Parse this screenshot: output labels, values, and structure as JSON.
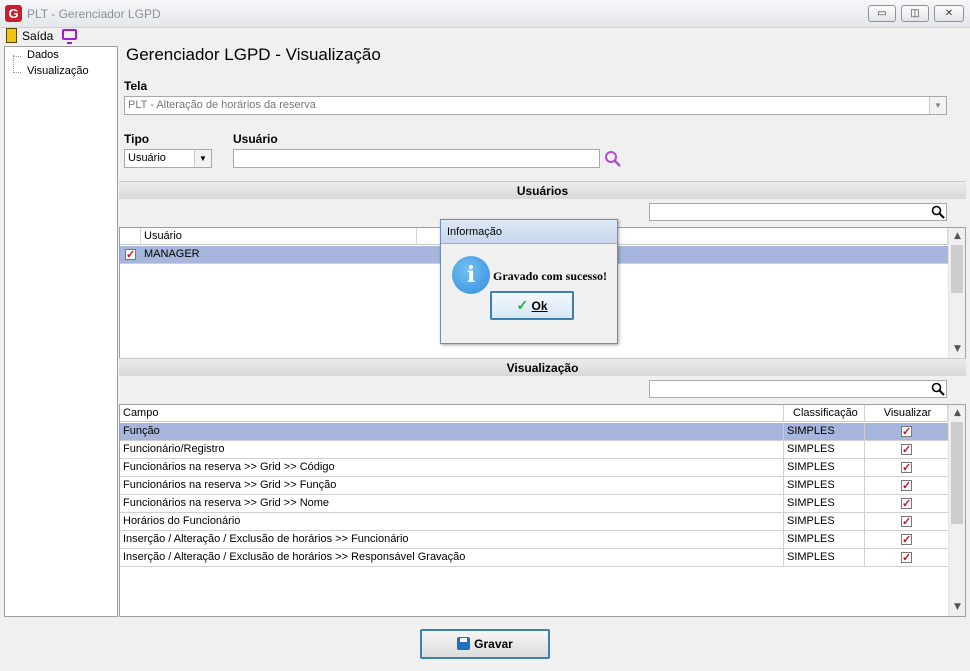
{
  "window": {
    "title": "PLT - Gerenciador LGPD",
    "app_icon": "G",
    "min_symbol": "▭",
    "max_symbol": "◫",
    "close_symbol": "✕"
  },
  "menu": {
    "exit_label": "Saída"
  },
  "tree": {
    "items": [
      {
        "label": "Dados"
      },
      {
        "label": "Visualização"
      }
    ]
  },
  "page": {
    "title": "Gerenciador LGPD - Visualização"
  },
  "form": {
    "tela_label": "Tela",
    "tela_value": "PLT - Alteração de horários da reserva",
    "tipo_label": "Tipo",
    "tipo_value": "Usuário",
    "usuario_label": "Usuário",
    "usuario_value": ""
  },
  "usuarios": {
    "header": "Usuários",
    "search_value": "",
    "columns": [
      "Usuário"
    ],
    "rows": [
      {
        "name": "MANAGER",
        "checked": true,
        "selected": true
      }
    ]
  },
  "visualizacao": {
    "header": "Visualização",
    "search_value": "",
    "columns": [
      "Campo",
      "Classificação",
      "Visualizar"
    ],
    "rows": [
      {
        "campo": "Função",
        "classificacao": "SIMPLES",
        "visualizar": true,
        "selected": true
      },
      {
        "campo": "Funcionário/Registro",
        "classificacao": "SIMPLES",
        "visualizar": true
      },
      {
        "campo": "Funcionários na reserva >> Grid >> Código",
        "classificacao": "SIMPLES",
        "visualizar": true
      },
      {
        "campo": "Funcionários na reserva >> Grid >> Função",
        "classificacao": "SIMPLES",
        "visualizar": true
      },
      {
        "campo": "Funcionários na reserva >> Grid >> Nome",
        "classificacao": "SIMPLES",
        "visualizar": true
      },
      {
        "campo": "Horários do Funcionário",
        "classificacao": "SIMPLES",
        "visualizar": true
      },
      {
        "campo": "Inserção / Alteração / Exclusão de horários >> Funcionário",
        "classificacao": "SIMPLES",
        "visualizar": true
      },
      {
        "campo": "Inserção / Alteração / Exclusão de horários >> Responsável Gravação",
        "classificacao": "SIMPLES",
        "visualizar": true
      }
    ]
  },
  "dialog": {
    "title": "Informação",
    "message": "Gravado com sucesso!",
    "icon_letter": "i",
    "ok_label": "Ok"
  },
  "actions": {
    "save_label": "Gravar"
  },
  "colors": {
    "selection": "#a7b6dd",
    "check": "#d0101a",
    "accent_border": "#3c7fb1"
  }
}
